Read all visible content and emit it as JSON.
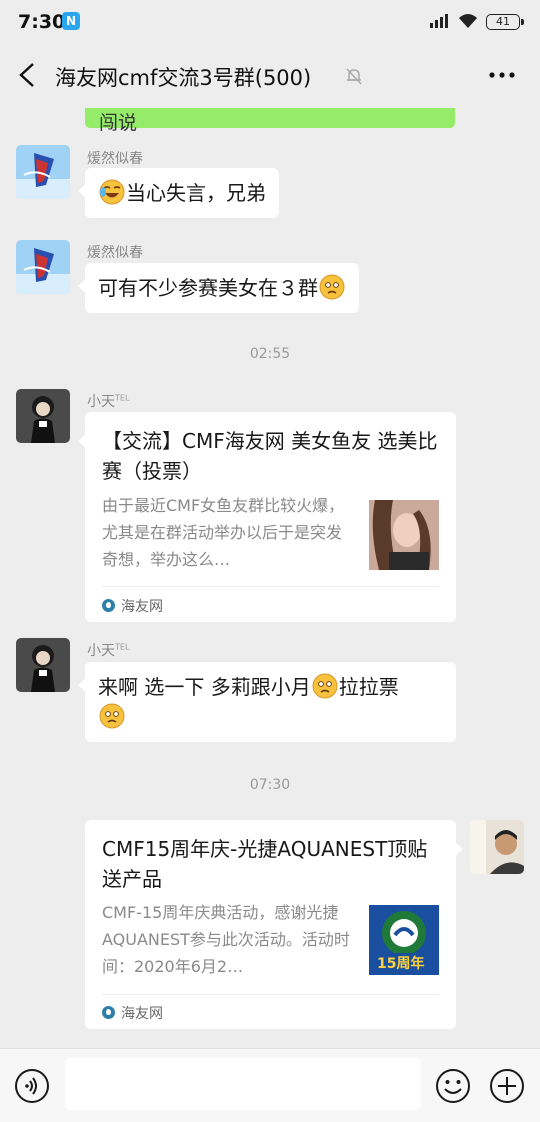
{
  "status_bar": {
    "time": "7:30",
    "notification_badge": "N",
    "battery": "41"
  },
  "header": {
    "title": "海友网cmf交流3号群(500)"
  },
  "chat": {
    "partial_top_message": "闯说",
    "messages": [
      {
        "sender": "煖然似春",
        "text": "当心失言，兄弟",
        "emoji_before": "laughing-crying-icon"
      },
      {
        "sender": "煖然似春",
        "text": "可有不少参赛美女在３群",
        "emoji_after": "thinking-icon"
      }
    ],
    "timestamp_1": "02:55",
    "card_1": {
      "sender": "小天",
      "sender_badge": "TEL",
      "title": "【交流】CMF海友网 美女鱼友 选美比赛（投票）",
      "desc": "由于最近CMF女鱼友群比较火爆，尤其是在群活动举办以后于是突发奇想，举办这么…",
      "source": "海友网"
    },
    "message_3": {
      "sender": "小天",
      "sender_badge": "TEL",
      "text_part1": "来啊 选一下 多莉跟小月",
      "text_part2": "拉拉票"
    },
    "timestamp_2": "07:30",
    "card_2": {
      "title": "CMF15周年庆-光捷AQUANEST顶贴送产品",
      "desc": "CMF-15周年庆典活动，感谢光捷AQUANEST参与此次活动。活动时间：2020年6月2…",
      "thumb_text": "15周年",
      "source": "海友网"
    }
  },
  "input_bar": {
    "placeholder": ""
  },
  "colors": {
    "bubble_green": "#95ec69",
    "background": "#ededed",
    "card_source_icon": "#2c7fa8"
  }
}
